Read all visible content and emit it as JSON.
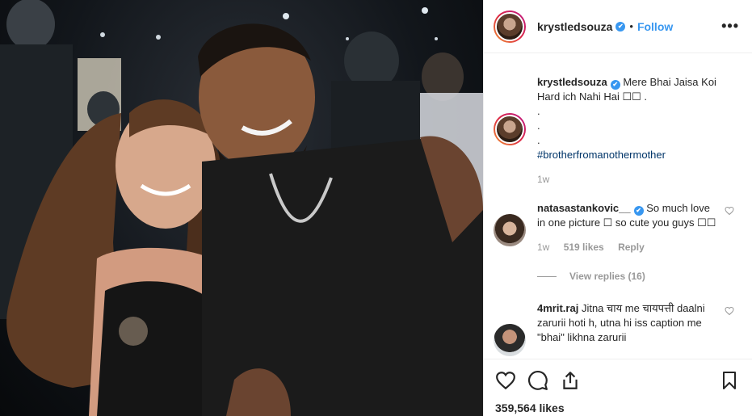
{
  "header": {
    "username": "krystledsouza",
    "verified_mark": "✔",
    "separator": "•",
    "follow_label": "Follow",
    "more_label": "•••"
  },
  "caption": {
    "username": "krystledsouza",
    "text": "Mere Bhai Jaisa Koi Hard ich Nahi Hai ☐☐ .",
    "dots": [
      ".",
      ".",
      "."
    ],
    "hashtag": "#brotherfromanothermother",
    "time": "1w"
  },
  "comments": [
    {
      "username": "natasastankovic__",
      "text": "So much love in one picture ☐ so cute you guys ☐☐",
      "time": "1w",
      "likes": "519 likes",
      "reply_label": "Reply",
      "view_replies": "View replies (16)"
    },
    {
      "username": "4mrit.raj",
      "text": "Jitna चाय me चायपत्ती daalni zarurii hoti h, utna hi iss caption me \"bhai\" likhna zarurii"
    }
  ],
  "actions": {
    "icons": [
      "heart-icon",
      "comment-icon",
      "share-icon",
      "bookmark-icon"
    ],
    "likes": "359,564 likes"
  },
  "colors": {
    "link": "#3897f0",
    "hashtag": "#003569",
    "muted": "#999999",
    "text": "#262626"
  }
}
